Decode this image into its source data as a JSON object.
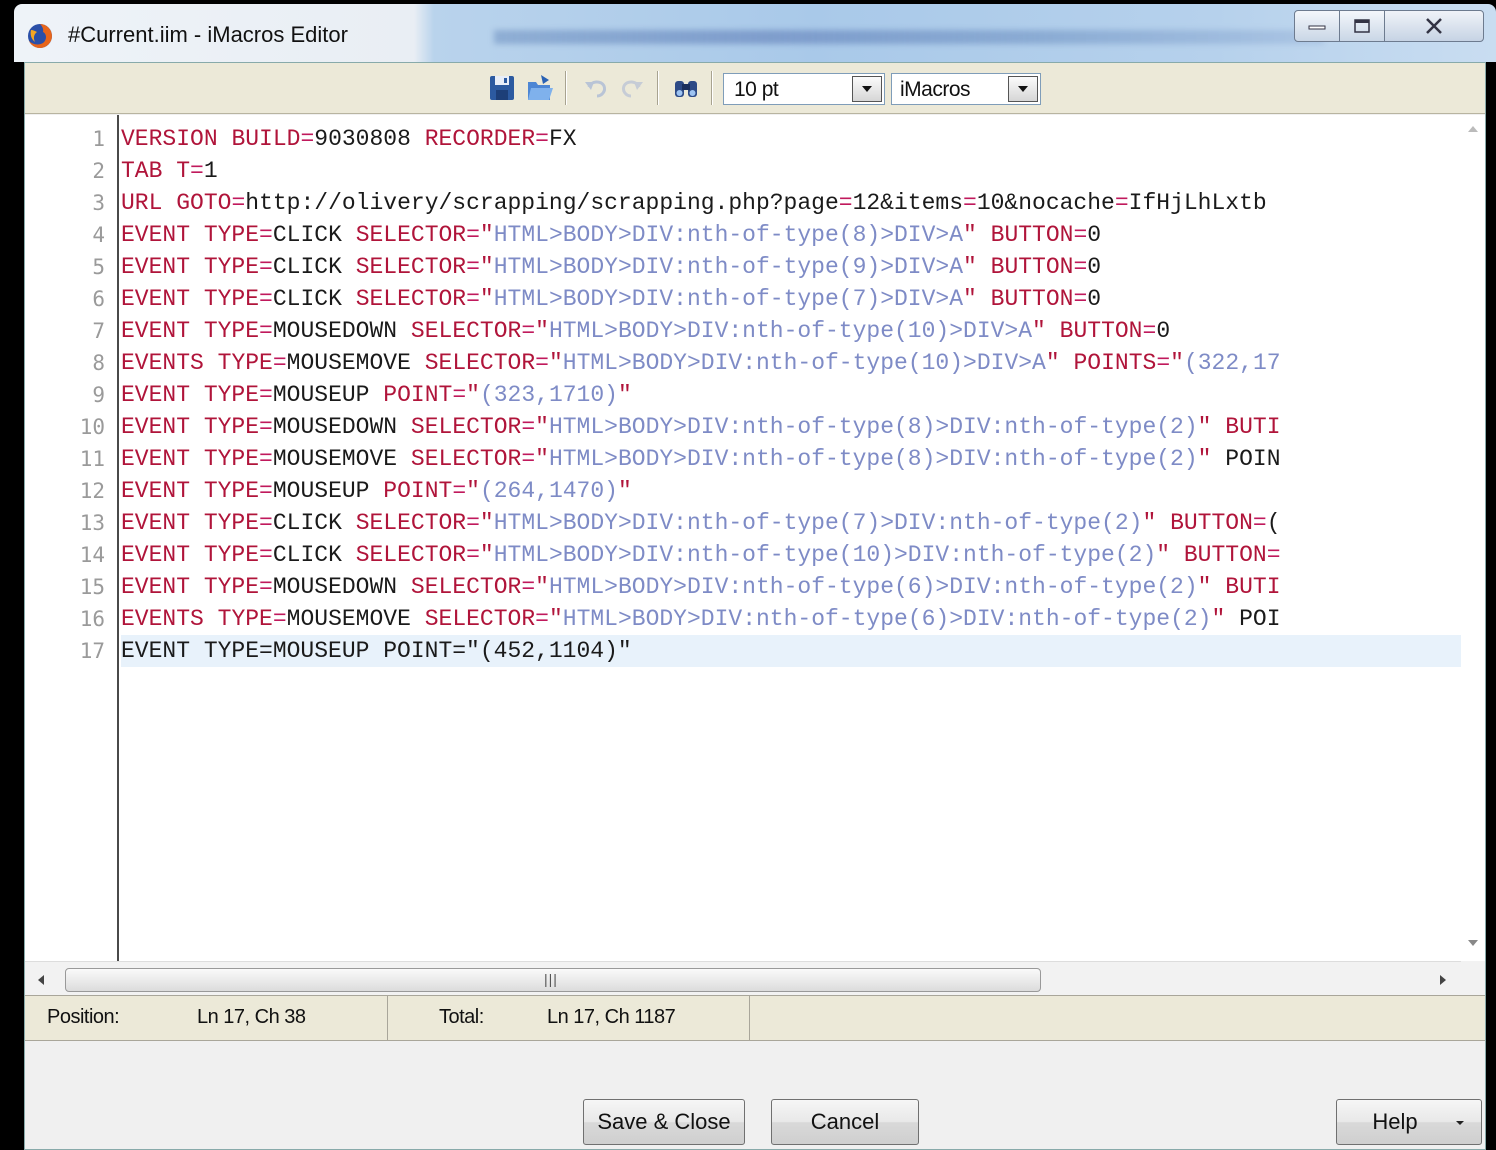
{
  "window": {
    "title": "#Current.iim - iMacros Editor",
    "app_icon": "firefox-icon",
    "controls": [
      "minimize-icon",
      "maximize-icon",
      "close-icon"
    ]
  },
  "toolbar": {
    "icons": [
      "save-icon",
      "open-icon",
      "undo-icon",
      "redo-icon",
      "find-icon"
    ],
    "font_size": "10 pt",
    "syntax": "iMacros"
  },
  "editor": {
    "line_numbers": [
      "1",
      "2",
      "3",
      "4",
      "5",
      "6",
      "7",
      "8",
      "9",
      "10",
      "11",
      "12",
      "13",
      "14",
      "15",
      "16",
      "17"
    ],
    "lines": [
      [
        [
          "VERSION",
          "kw"
        ],
        [
          " ",
          ""
        ],
        [
          "BUILD",
          "kw"
        ],
        [
          "=",
          "eq"
        ],
        [
          "9030808",
          ""
        ],
        [
          " ",
          ""
        ],
        [
          "RECORDER",
          "kw"
        ],
        [
          "=",
          "eq"
        ],
        [
          "FX",
          ""
        ]
      ],
      [
        [
          "TAB",
          "kw"
        ],
        [
          " ",
          ""
        ],
        [
          "T",
          "kw"
        ],
        [
          "=",
          "eq"
        ],
        [
          "1",
          ""
        ]
      ],
      [
        [
          "URL",
          "kw"
        ],
        [
          " ",
          ""
        ],
        [
          "GOTO",
          "kw"
        ],
        [
          "=",
          "eq"
        ],
        [
          "http://olivery/scrapping/scrapping.php?page",
          ""
        ],
        [
          "=",
          "eq"
        ],
        [
          "12&items",
          ""
        ],
        [
          "=",
          "eq"
        ],
        [
          "10&nocache",
          ""
        ],
        [
          "=",
          "eq"
        ],
        [
          "IfHjLhLxtb",
          ""
        ]
      ],
      [
        [
          "EVENT",
          "kw"
        ],
        [
          " ",
          ""
        ],
        [
          "TYPE",
          "kw"
        ],
        [
          "=",
          "eq"
        ],
        [
          "CLICK",
          ""
        ],
        [
          " ",
          ""
        ],
        [
          "SELECTOR",
          "kw"
        ],
        [
          "=",
          "eq"
        ],
        [
          "\"",
          "q"
        ],
        [
          "HTML>BODY>DIV:nth-of-type(8)>DIV>A",
          "str"
        ],
        [
          "\"",
          "q"
        ],
        [
          " ",
          ""
        ],
        [
          "BUTTON",
          "kw"
        ],
        [
          "=",
          "eq"
        ],
        [
          "0",
          ""
        ]
      ],
      [
        [
          "EVENT",
          "kw"
        ],
        [
          " ",
          ""
        ],
        [
          "TYPE",
          "kw"
        ],
        [
          "=",
          "eq"
        ],
        [
          "CLICK",
          ""
        ],
        [
          " ",
          ""
        ],
        [
          "SELECTOR",
          "kw"
        ],
        [
          "=",
          "eq"
        ],
        [
          "\"",
          "q"
        ],
        [
          "HTML>BODY>DIV:nth-of-type(9)>DIV>A",
          "str"
        ],
        [
          "\"",
          "q"
        ],
        [
          " ",
          ""
        ],
        [
          "BUTTON",
          "kw"
        ],
        [
          "=",
          "eq"
        ],
        [
          "0",
          ""
        ]
      ],
      [
        [
          "EVENT",
          "kw"
        ],
        [
          " ",
          ""
        ],
        [
          "TYPE",
          "kw"
        ],
        [
          "=",
          "eq"
        ],
        [
          "CLICK",
          ""
        ],
        [
          " ",
          ""
        ],
        [
          "SELECTOR",
          "kw"
        ],
        [
          "=",
          "eq"
        ],
        [
          "\"",
          "q"
        ],
        [
          "HTML>BODY>DIV:nth-of-type(7)>DIV>A",
          "str"
        ],
        [
          "\"",
          "q"
        ],
        [
          " ",
          ""
        ],
        [
          "BUTTON",
          "kw"
        ],
        [
          "=",
          "eq"
        ],
        [
          "0",
          ""
        ]
      ],
      [
        [
          "EVENT",
          "kw"
        ],
        [
          " ",
          ""
        ],
        [
          "TYPE",
          "kw"
        ],
        [
          "=",
          "eq"
        ],
        [
          "MOUSEDOWN",
          ""
        ],
        [
          " ",
          ""
        ],
        [
          "SELECTOR",
          "kw"
        ],
        [
          "=",
          "eq"
        ],
        [
          "\"",
          "q"
        ],
        [
          "HTML>BODY>DIV:nth-of-type(10)>DIV>A",
          "str"
        ],
        [
          "\"",
          "q"
        ],
        [
          " ",
          ""
        ],
        [
          "BUTTON",
          "kw"
        ],
        [
          "=",
          "eq"
        ],
        [
          "0",
          ""
        ]
      ],
      [
        [
          "EVENTS",
          "kw"
        ],
        [
          " ",
          ""
        ],
        [
          "TYPE",
          "kw"
        ],
        [
          "=",
          "eq"
        ],
        [
          "MOUSEMOVE",
          ""
        ],
        [
          " ",
          ""
        ],
        [
          "SELECTOR",
          "kw"
        ],
        [
          "=",
          "eq"
        ],
        [
          "\"",
          "q"
        ],
        [
          "HTML>BODY>DIV:nth-of-type(10)>DIV>A",
          "str"
        ],
        [
          "\"",
          "q"
        ],
        [
          " ",
          ""
        ],
        [
          "POINTS",
          "kw"
        ],
        [
          "=",
          "eq"
        ],
        [
          "\"",
          "q"
        ],
        [
          "(322,17",
          "str"
        ]
      ],
      [
        [
          "EVENT",
          "kw"
        ],
        [
          " ",
          ""
        ],
        [
          "TYPE",
          "kw"
        ],
        [
          "=",
          "eq"
        ],
        [
          "MOUSEUP",
          ""
        ],
        [
          " ",
          ""
        ],
        [
          "POINT",
          "kw"
        ],
        [
          "=",
          "eq"
        ],
        [
          "\"",
          "q"
        ],
        [
          "(323,1710)",
          "str"
        ],
        [
          "\"",
          "q"
        ]
      ],
      [
        [
          "EVENT",
          "kw"
        ],
        [
          " ",
          ""
        ],
        [
          "TYPE",
          "kw"
        ],
        [
          "=",
          "eq"
        ],
        [
          "MOUSEDOWN",
          ""
        ],
        [
          " ",
          ""
        ],
        [
          "SELECTOR",
          "kw"
        ],
        [
          "=",
          "eq"
        ],
        [
          "\"",
          "q"
        ],
        [
          "HTML>BODY>DIV:nth-of-type(8)>DIV:nth-of-type(2)",
          "str"
        ],
        [
          "\"",
          "q"
        ],
        [
          " ",
          ""
        ],
        [
          "BUTI",
          "kw"
        ]
      ],
      [
        [
          "EVENT",
          "kw"
        ],
        [
          " ",
          ""
        ],
        [
          "TYPE",
          "kw"
        ],
        [
          "=",
          "eq"
        ],
        [
          "MOUSEMOVE",
          ""
        ],
        [
          " ",
          ""
        ],
        [
          "SELECTOR",
          "kw"
        ],
        [
          "=",
          "eq"
        ],
        [
          "\"",
          "q"
        ],
        [
          "HTML>BODY>DIV:nth-of-type(8)>DIV:nth-of-type(2)",
          "str"
        ],
        [
          "\"",
          "q"
        ],
        [
          " ",
          ""
        ],
        [
          "POIN",
          ""
        ]
      ],
      [
        [
          "EVENT",
          "kw"
        ],
        [
          " ",
          ""
        ],
        [
          "TYPE",
          "kw"
        ],
        [
          "=",
          "eq"
        ],
        [
          "MOUSEUP",
          ""
        ],
        [
          " ",
          ""
        ],
        [
          "POINT",
          "kw"
        ],
        [
          "=",
          "eq"
        ],
        [
          "\"",
          "q"
        ],
        [
          "(264,1470)",
          "str"
        ],
        [
          "\"",
          "q"
        ]
      ],
      [
        [
          "EVENT",
          "kw"
        ],
        [
          " ",
          ""
        ],
        [
          "TYPE",
          "kw"
        ],
        [
          "=",
          "eq"
        ],
        [
          "CLICK",
          ""
        ],
        [
          " ",
          ""
        ],
        [
          "SELECTOR",
          "kw"
        ],
        [
          "=",
          "eq"
        ],
        [
          "\"",
          "q"
        ],
        [
          "HTML>BODY>DIV:nth-of-type(7)>DIV:nth-of-type(2)",
          "str"
        ],
        [
          "\"",
          "q"
        ],
        [
          " ",
          ""
        ],
        [
          "BUTTON",
          "kw"
        ],
        [
          "=",
          "eq"
        ],
        [
          "(",
          ""
        ]
      ],
      [
        [
          "EVENT",
          "kw"
        ],
        [
          " ",
          ""
        ],
        [
          "TYPE",
          "kw"
        ],
        [
          "=",
          "eq"
        ],
        [
          "CLICK",
          ""
        ],
        [
          " ",
          ""
        ],
        [
          "SELECTOR",
          "kw"
        ],
        [
          "=",
          "eq"
        ],
        [
          "\"",
          "q"
        ],
        [
          "HTML>BODY>DIV:nth-of-type(10)>DIV:nth-of-type(2)",
          "str"
        ],
        [
          "\"",
          "q"
        ],
        [
          " ",
          ""
        ],
        [
          "BUTTON",
          "kw"
        ],
        [
          "=",
          "eq"
        ]
      ],
      [
        [
          "EVENT",
          "kw"
        ],
        [
          " ",
          ""
        ],
        [
          "TYPE",
          "kw"
        ],
        [
          "=",
          "eq"
        ],
        [
          "MOUSEDOWN",
          ""
        ],
        [
          " ",
          ""
        ],
        [
          "SELECTOR",
          "kw"
        ],
        [
          "=",
          "eq"
        ],
        [
          "\"",
          "q"
        ],
        [
          "HTML>BODY>DIV:nth-of-type(6)>DIV:nth-of-type(2)",
          "str"
        ],
        [
          "\"",
          "q"
        ],
        [
          " ",
          ""
        ],
        [
          "BUTI",
          "kw"
        ]
      ],
      [
        [
          "EVENTS",
          "kw"
        ],
        [
          " ",
          ""
        ],
        [
          "TYPE",
          "kw"
        ],
        [
          "=",
          "eq"
        ],
        [
          "MOUSEMOVE",
          ""
        ],
        [
          " ",
          ""
        ],
        [
          "SELECTOR",
          "kw"
        ],
        [
          "=",
          "eq"
        ],
        [
          "\"",
          "q"
        ],
        [
          "HTML>BODY>DIV:nth-of-type(6)>DIV:nth-of-type(2)",
          "str"
        ],
        [
          "\"",
          "q"
        ],
        [
          " ",
          ""
        ],
        [
          "POI",
          ""
        ]
      ],
      [
        [
          "EVENT TYPE=MOUSEUP POINT=\"(452,1104)\"",
          ""
        ]
      ]
    ],
    "current_line": 17
  },
  "status": {
    "position_label": "Position:",
    "position_value": "Ln 17, Ch 38",
    "total_label": "Total:",
    "total_value": "Ln 17, Ch 1187"
  },
  "buttons": {
    "save_close": "Save & Close",
    "cancel": "Cancel",
    "help": "Help"
  },
  "colors": {
    "keyword": "#b0143a",
    "operator": "#c0195c",
    "string": "#7e8bc6",
    "toolbar_bg": "#ece9d8",
    "current_line_bg": "#e8f2fb"
  }
}
